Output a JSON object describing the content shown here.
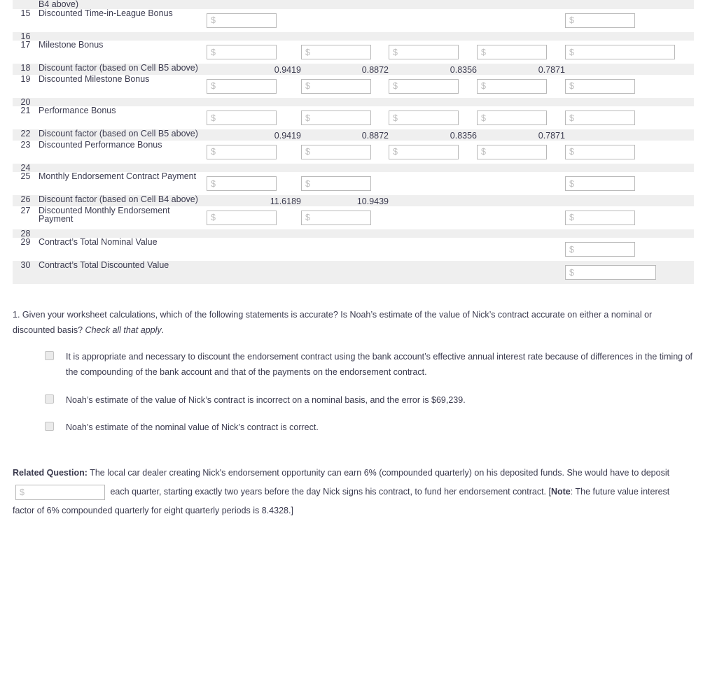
{
  "worksheet": {
    "money_placeholder": "$",
    "rows": [
      {
        "num": "",
        "label": "B4 above)",
        "shade": true,
        "partial": true,
        "cells": [
          {
            "type": "empty"
          },
          {
            "type": "empty"
          },
          {
            "type": "empty"
          },
          {
            "type": "empty"
          },
          {
            "type": "empty"
          }
        ]
      },
      {
        "num": "15",
        "label": "Discounted Time-in-League Bonus",
        "shade": false,
        "cells": [
          {
            "type": "input",
            "width": "w100"
          },
          {
            "type": "empty"
          },
          {
            "type": "empty"
          },
          {
            "type": "empty"
          },
          {
            "type": "input",
            "width": "w100"
          }
        ]
      },
      {
        "num": "16",
        "label": "",
        "shade": true,
        "cells": [
          {
            "type": "empty"
          },
          {
            "type": "empty"
          },
          {
            "type": "empty"
          },
          {
            "type": "empty"
          },
          {
            "type": "empty"
          }
        ]
      },
      {
        "num": "17",
        "label": "Milestone Bonus",
        "shade": false,
        "cells": [
          {
            "type": "input",
            "width": "w100"
          },
          {
            "type": "input",
            "width": "w100"
          },
          {
            "type": "input",
            "width": "w100"
          },
          {
            "type": "input",
            "width": "w100"
          },
          {
            "type": "input",
            "width": "w155",
            "align": "wide"
          }
        ]
      },
      {
        "num": "18",
        "label": "Discount factor (based on Cell B5 above)",
        "shade": true,
        "cells": [
          {
            "type": "value",
            "value": "0.9419"
          },
          {
            "type": "value",
            "value": "0.8872"
          },
          {
            "type": "value",
            "value": "0.8356"
          },
          {
            "type": "value",
            "value": "0.7871"
          },
          {
            "type": "empty"
          }
        ]
      },
      {
        "num": "19",
        "label": "Discounted Milestone Bonus",
        "shade": false,
        "cells": [
          {
            "type": "input",
            "width": "w100"
          },
          {
            "type": "input",
            "width": "w100"
          },
          {
            "type": "input",
            "width": "w100"
          },
          {
            "type": "input",
            "width": "w100"
          },
          {
            "type": "input",
            "width": "w100"
          }
        ]
      },
      {
        "num": "20",
        "label": "",
        "shade": true,
        "cells": [
          {
            "type": "empty"
          },
          {
            "type": "empty"
          },
          {
            "type": "empty"
          },
          {
            "type": "empty"
          },
          {
            "type": "empty"
          }
        ]
      },
      {
        "num": "21",
        "label": "Performance Bonus",
        "shade": false,
        "cells": [
          {
            "type": "input",
            "width": "w100"
          },
          {
            "type": "input",
            "width": "w100"
          },
          {
            "type": "input",
            "width": "w100"
          },
          {
            "type": "input",
            "width": "w100"
          },
          {
            "type": "input",
            "width": "w100"
          }
        ]
      },
      {
        "num": "22",
        "label": "Discount factor (based on Cell B5 above)",
        "shade": true,
        "cells": [
          {
            "type": "value",
            "value": "0.9419"
          },
          {
            "type": "value",
            "value": "0.8872"
          },
          {
            "type": "value",
            "value": "0.8356"
          },
          {
            "type": "value",
            "value": "0.7871"
          },
          {
            "type": "empty"
          }
        ]
      },
      {
        "num": "23",
        "label": "Discounted Performance Bonus",
        "shade": false,
        "cells": [
          {
            "type": "input",
            "width": "w100"
          },
          {
            "type": "input",
            "width": "w100"
          },
          {
            "type": "input",
            "width": "w100"
          },
          {
            "type": "input",
            "width": "w100"
          },
          {
            "type": "input",
            "width": "w100"
          }
        ]
      },
      {
        "num": "24",
        "label": "",
        "shade": true,
        "cells": [
          {
            "type": "empty"
          },
          {
            "type": "empty"
          },
          {
            "type": "empty"
          },
          {
            "type": "empty"
          },
          {
            "type": "empty"
          }
        ]
      },
      {
        "num": "25",
        "label": "Monthly Endorsement Contract Payment",
        "shade": false,
        "cells": [
          {
            "type": "input",
            "width": "w100"
          },
          {
            "type": "input",
            "width": "w100"
          },
          {
            "type": "empty"
          },
          {
            "type": "empty"
          },
          {
            "type": "input",
            "width": "w100"
          }
        ]
      },
      {
        "num": "26",
        "label": "Discount factor (based on Cell B4 above)",
        "shade": true,
        "cells": [
          {
            "type": "value",
            "value": "11.6189"
          },
          {
            "type": "value",
            "value": "10.9439"
          },
          {
            "type": "empty"
          },
          {
            "type": "empty"
          },
          {
            "type": "empty"
          }
        ]
      },
      {
        "num": "27",
        "label": "Discounted Monthly Endorsement Payment",
        "shade": false,
        "cells": [
          {
            "type": "input",
            "width": "w100"
          },
          {
            "type": "input",
            "width": "w100"
          },
          {
            "type": "empty"
          },
          {
            "type": "empty"
          },
          {
            "type": "input",
            "width": "w100"
          }
        ]
      },
      {
        "num": "28",
        "label": "",
        "shade": true,
        "cells": [
          {
            "type": "empty"
          },
          {
            "type": "empty"
          },
          {
            "type": "empty"
          },
          {
            "type": "empty"
          },
          {
            "type": "empty"
          }
        ]
      },
      {
        "num": "29",
        "label": "Contract’s Total Nominal Value",
        "shade": false,
        "cells": [
          {
            "type": "empty"
          },
          {
            "type": "empty"
          },
          {
            "type": "empty"
          },
          {
            "type": "empty"
          },
          {
            "type": "input",
            "width": "w100"
          }
        ]
      },
      {
        "num": "30",
        "label": "Contract’s Total Discounted Value",
        "shade": true,
        "cells": [
          {
            "type": "empty"
          },
          {
            "type": "empty"
          },
          {
            "type": "empty"
          },
          {
            "type": "empty"
          },
          {
            "type": "input",
            "width": "w130",
            "align": "r30"
          }
        ]
      }
    ]
  },
  "question": {
    "prompt_part1": "1. Given your worksheet calculations, which of the following statements is accurate? Is Noah’s estimate of the value of Nick’s contract accurate on either a nominal or discounted basis? ",
    "prompt_italic": "Check all that apply",
    "prompt_part2": ".",
    "options": [
      "It is appropriate and necessary to discount the endorsement contract using the bank account’s effective annual interest rate because of differences in the timing of the compounding of the bank account and that of the payments on the endorsement contract.",
      "Noah’s estimate of the value of Nick’s contract is incorrect on a nominal basis, and the error is $69,239.",
      "Noah’s estimate of the nominal value of Nick’s contract is correct."
    ]
  },
  "related_question": {
    "heading": "Related Question:",
    "text_before_input": " The local car dealer creating Nick's endorsement opportunity can earn 6% (compounded quarterly) on his deposited funds. She would have to deposit",
    "input_placeholder": "$",
    "text_after_input": "each quarter, starting exactly two years before the day Nick signs his contract, to fund her endorsement contract. [",
    "note_label": "Note",
    "note_text": ": The future value interest factor of 6% compounded quarterly for eight quarterly periods is 8.4328.]"
  }
}
